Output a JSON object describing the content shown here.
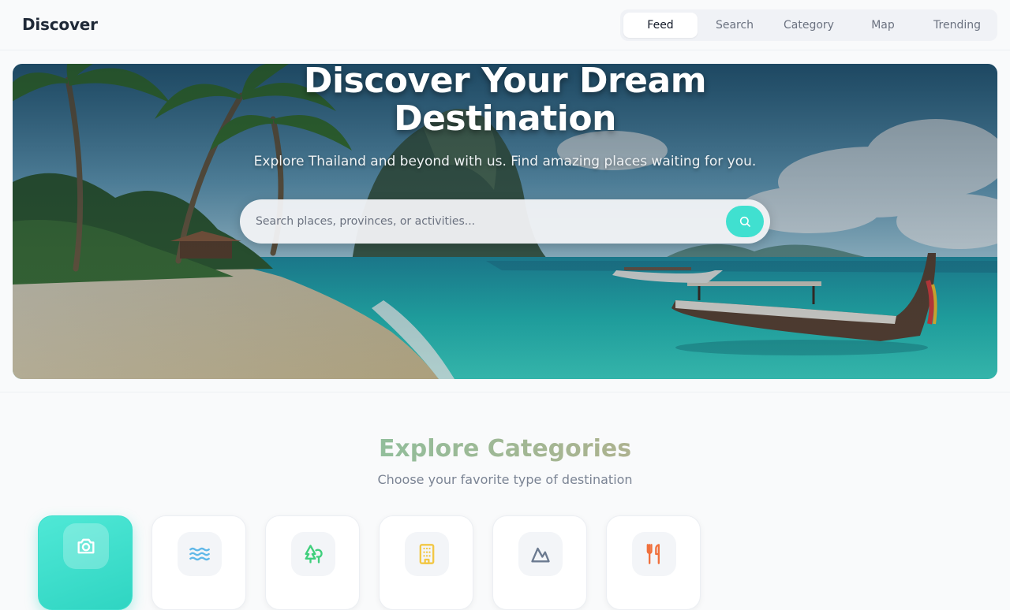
{
  "header": {
    "brand": "Discover",
    "tabs": [
      {
        "label": "Feed",
        "active": true
      },
      {
        "label": "Search",
        "active": false
      },
      {
        "label": "Category",
        "active": false
      },
      {
        "label": "Map",
        "active": false
      },
      {
        "label": "Trending",
        "active": false
      }
    ]
  },
  "hero": {
    "title": "Discover Your Dream Destination",
    "subtitle": "Explore Thailand and beyond with us. Find amazing places waiting for you.",
    "search": {
      "placeholder": "Search places, provinces, or activities...",
      "value": "",
      "button_icon": "search-icon"
    },
    "background_image": "tropical-beach-longtail-boat"
  },
  "categories": {
    "title": "Explore Categories",
    "subtitle": "Choose your favorite type of destination",
    "items": [
      {
        "icon": "camera-icon",
        "color": "#ffffff",
        "active": true
      },
      {
        "icon": "waves-icon",
        "color": "#60b8e8",
        "active": false
      },
      {
        "icon": "trees-icon",
        "color": "#3fcf7c",
        "active": false
      },
      {
        "icon": "building-icon",
        "color": "#f2c744",
        "active": false
      },
      {
        "icon": "mountain-icon",
        "color": "#6b7a90",
        "active": false
      },
      {
        "icon": "utensils-icon",
        "color": "#f0703c",
        "active": false
      }
    ]
  },
  "colors": {
    "accent": "#40e0d0",
    "background": "#f9fafb",
    "title_gradient_start": "#86c3a0",
    "title_gradient_end": "#b9ad8a"
  }
}
